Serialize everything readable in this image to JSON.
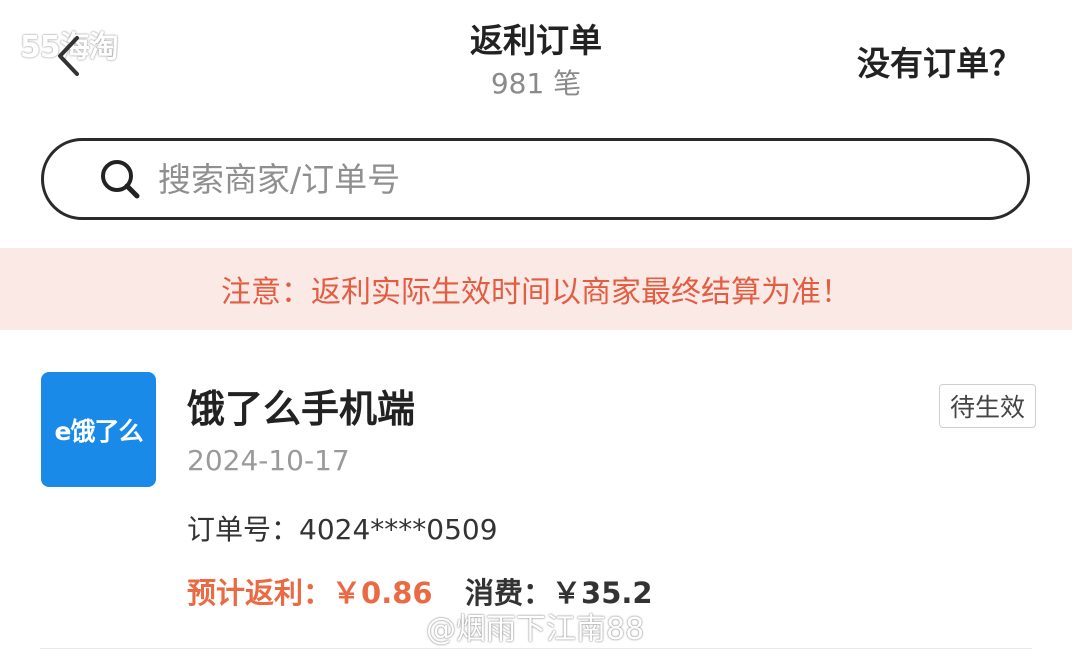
{
  "watermark_top": "55海淘",
  "header": {
    "title": "返利订单",
    "subtitle": "981 笔",
    "help_link": "没有订单？"
  },
  "search": {
    "placeholder": "搜索商家/订单号",
    "value": ""
  },
  "notice": "注意：返利实际生效时间以商家最终结算为准！",
  "order": {
    "logo_text": "e饿了么",
    "shop_name": "饿了么手机端",
    "status": "待生效",
    "date": "2024-10-17",
    "order_no_label": "订单号：",
    "order_no": "4024****0509",
    "rebate_label": "预计返利：",
    "rebate_value": "￥0.86",
    "spend_label": "消费：",
    "spend_value": "￥35.2"
  },
  "watermark_bottom": "@烟雨下江南88",
  "colors": {
    "accent": "#ea6a44",
    "notice_bg": "#fbe9e6",
    "notice_text": "#e35d43",
    "logo_bg": "#1a8ae8"
  }
}
